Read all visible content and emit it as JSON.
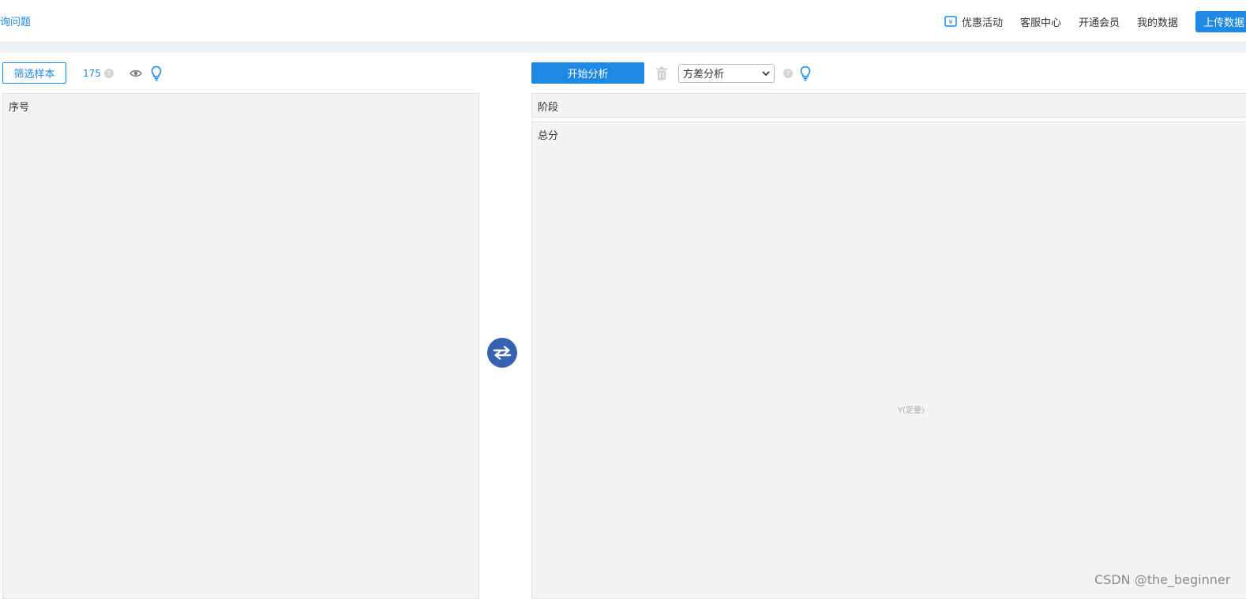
{
  "header": {
    "left_link": "询问题",
    "nav": {
      "promo": "优惠活动",
      "service": "客服中心",
      "vip": "开通会员",
      "my_data": "我的数据",
      "upload": "上传数据"
    }
  },
  "toolbar_left": {
    "filter_label": "筛选样本",
    "sample_count": "175"
  },
  "toolbar_right": {
    "start_label": "开始分析",
    "method_selected": "方差分析"
  },
  "panels": {
    "variable_list": [
      "序号"
    ],
    "x_variables": [
      "阶段"
    ],
    "y_variables": [
      "总分"
    ],
    "y_hint": "Y(定量)"
  },
  "watermark": "CSDN @the_beginner",
  "colors": {
    "accent": "#1e88e5",
    "swap_button": "#3563b2",
    "panel_bg": "#f4f4f4"
  }
}
